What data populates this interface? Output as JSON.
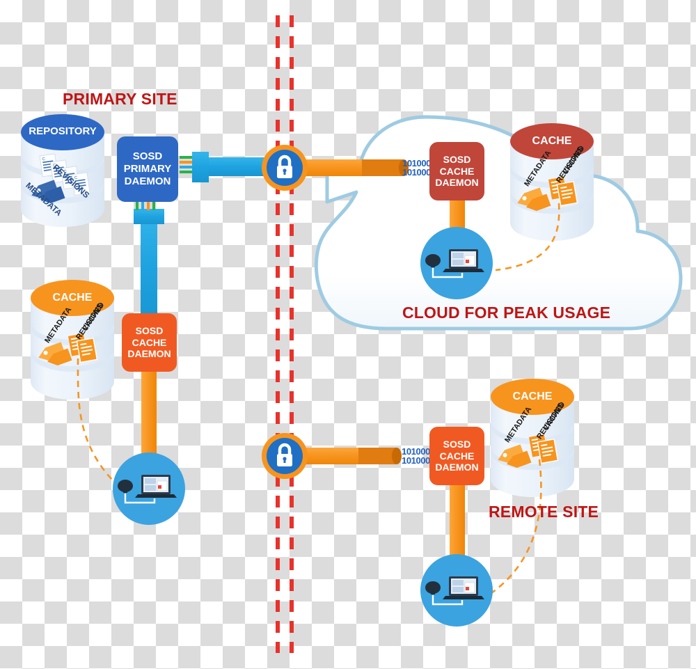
{
  "diagram": {
    "title_primary": "PRIMARY SITE",
    "title_cloud": "CLOUD FOR PEAK USAGE",
    "title_remote": "REMOTE SITE"
  },
  "colors": {
    "title_red": "#bf1515",
    "primary_daemon_blue": "#2d68c4",
    "repository_top_blue": "#2d68c4",
    "cache_orange": "#f7941e",
    "cache_cloud_red": "#c0463a",
    "daemon_orange": "#f05a22",
    "daemon_cloud_red": "#c0463a",
    "pipe_blue": "#29abe2",
    "pipe_orange": "#f7941e",
    "cloud_outline": "#9ecbe2",
    "cylinder_body": "#eaf1f9",
    "dashed_border_red": "#e8322b",
    "lock_ring_orange": "#f7941e",
    "lock_circle_blue": "#1f6fc4",
    "device_circle_blue": "#3ba3e0",
    "binary_text_blue": "#1f5fbf"
  },
  "primary_site": {
    "label": "PRIMARY SITE",
    "repository": {
      "name": "REPOSITORY",
      "annotations": [
        "REVISIONS",
        "METADATA"
      ]
    },
    "daemon": {
      "lines": [
        "SOSD",
        "PRIMARY",
        "DAEMON"
      ],
      "text": "SOSD PRIMARY DAEMON"
    },
    "cache": {
      "name": "CACHE",
      "annotations": [
        "CACHED REVISIONS",
        "METADATA"
      ],
      "annotation_cached": "CACHED",
      "annotation_revisions": "REVISIONS",
      "annotation_metadata": "METADATA"
    },
    "cache_daemon": {
      "lines": [
        "SOSD",
        "CACHE",
        "DAEMON"
      ],
      "text": "SOSD CACHE DAEMON"
    },
    "client": {
      "name": "workstation"
    }
  },
  "cloud_site": {
    "label": "CLOUD FOR PEAK USAGE",
    "cache": {
      "name": "CACHE",
      "annotation_cached": "CACHED",
      "annotation_revisions": "REVISIONS",
      "annotation_metadata": "METADATA"
    },
    "cache_daemon": {
      "lines": [
        "SOSD",
        "CACHE",
        "DAEMON"
      ],
      "text": "SOSD CACHE DAEMON"
    },
    "binary_stream": {
      "line1": "101000",
      "line2": "101000"
    },
    "client": {
      "name": "workstation"
    }
  },
  "remote_site": {
    "label": "REMOTE SITE",
    "cache": {
      "name": "CACHE",
      "annotation_cached": "CACHED",
      "annotation_revisions": "REVISIONS",
      "annotation_metadata": "METADATA"
    },
    "cache_daemon": {
      "lines": [
        "SOSD",
        "CACHE",
        "DAEMON"
      ],
      "text": "SOSD CACHE DAEMON"
    },
    "binary_stream": {
      "line1": "101000",
      "line2": "101000"
    },
    "client": {
      "name": "workstation"
    }
  },
  "security": {
    "lock_top": "secure-connection-lock",
    "lock_bottom": "secure-connection-lock"
  },
  "boundary": {
    "name": "network-boundary-dashed-line"
  }
}
